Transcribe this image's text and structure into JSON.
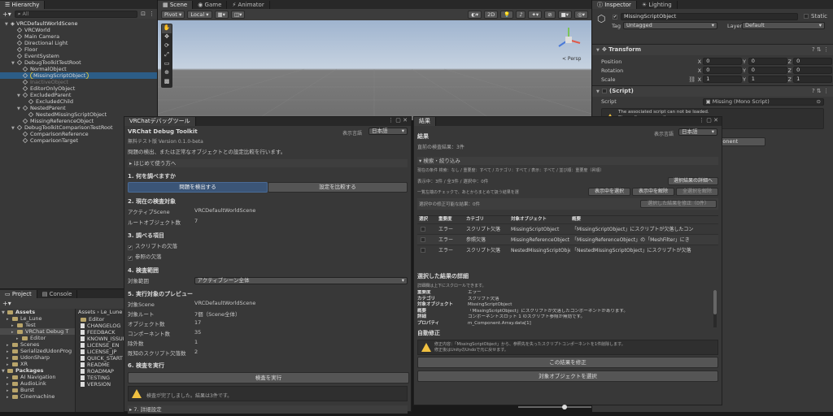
{
  "hierarchy": {
    "tab": "Hierarchy",
    "search_placeholder": "All",
    "scene": "VRCDefaultWorldScene",
    "items": [
      {
        "label": "VRCWorld",
        "indent": 2,
        "sel": false
      },
      {
        "label": "Main Camera",
        "indent": 2,
        "sel": false
      },
      {
        "label": "Directional Light",
        "indent": 2,
        "sel": false
      },
      {
        "label": "Floor",
        "indent": 2,
        "sel": false
      },
      {
        "label": "EventSystem",
        "indent": 2,
        "sel": false
      },
      {
        "label": "DebugToolkitTestRoot",
        "indent": 2,
        "sel": false,
        "open": true
      },
      {
        "label": "NormalObject",
        "indent": 3,
        "sel": false
      },
      {
        "label": "MissingScriptObject",
        "indent": 3,
        "sel": true
      },
      {
        "label": "InactiveObject",
        "indent": 3,
        "sel": false,
        "dim": true
      },
      {
        "label": "EditorOnlyObject",
        "indent": 3,
        "sel": false
      },
      {
        "label": "ExcludedParent",
        "indent": 3,
        "sel": false,
        "open": true
      },
      {
        "label": "ExcludedChild",
        "indent": 4,
        "sel": false
      },
      {
        "label": "NestedParent",
        "indent": 3,
        "sel": false,
        "open": true
      },
      {
        "label": "NestedMissingScriptObject",
        "indent": 4,
        "sel": false
      },
      {
        "label": "MissingReferenceObject",
        "indent": 3,
        "sel": false
      },
      {
        "label": "DebugToolkitComparisonTestRoot",
        "indent": 2,
        "sel": false,
        "open": true
      },
      {
        "label": "ComparisonReference",
        "indent": 3,
        "sel": false
      },
      {
        "label": "ComparisonTarget",
        "indent": 3,
        "sel": false
      }
    ]
  },
  "scene_view": {
    "tabs": [
      "Scene",
      "Game",
      "Animator"
    ],
    "pivot": "Pivot",
    "local": "Local",
    "mode2d": "2D",
    "persp": "< Persp"
  },
  "inspector": {
    "tabs": [
      "Inspector",
      "Lighting"
    ],
    "object_name": "MissingScriptObject",
    "static_label": "Static",
    "tag_label": "Tag",
    "tag_value": "Untagged",
    "layer_label": "Layer",
    "layer_value": "Default",
    "transform": "Transform",
    "position": "Position",
    "rotation": "Rotation",
    "scale": "Scale",
    "pos": [
      "0",
      "0",
      "0"
    ],
    "rot": [
      "0",
      "0",
      "0"
    ],
    "scl": [
      "1",
      "1",
      "1"
    ],
    "axes": [
      "X",
      "Y",
      "Z"
    ],
    "script_header": "(Script)",
    "script_label": "Script",
    "script_value": "Missing (Mono Script)",
    "warning": "The associated script can not be loaded.\nPlease fix any compile errors\nand assign a valid script.",
    "add_component": "Add Component"
  },
  "project": {
    "tabs": [
      "Project",
      "Console"
    ],
    "tree": [
      {
        "label": "Assets",
        "indent": 0,
        "bold": true
      },
      {
        "label": "Le_Lune",
        "indent": 1
      },
      {
        "label": "Test",
        "indent": 2
      },
      {
        "label": "VRChat Debug T",
        "indent": 2,
        "sel": true
      },
      {
        "label": "Editor",
        "indent": 3
      },
      {
        "label": "Scenes",
        "indent": 1
      },
      {
        "label": "SerializedUdonProg",
        "indent": 1
      },
      {
        "label": "UdonSharp",
        "indent": 1
      },
      {
        "label": "XR",
        "indent": 1
      },
      {
        "label": "Packages",
        "indent": 0,
        "bold": true
      },
      {
        "label": "AI Navigation",
        "indent": 1
      },
      {
        "label": "AudioLink",
        "indent": 1
      },
      {
        "label": "Burst",
        "indent": 1
      },
      {
        "label": "Cinemachine",
        "indent": 1
      }
    ],
    "breadcrumb": [
      "Assets",
      "Le_Lune"
    ],
    "files": [
      "Editor",
      "CHANGELOG",
      "FEEDBACK",
      "KNOWN_ISSUE",
      "LICENSE_EN",
      "LICENSE_JP",
      "QUICK_START",
      "README",
      "ROADMAP",
      "TESTING",
      "VERSION"
    ]
  },
  "debug": {
    "tab": "VRChatデバッグツール",
    "title": "VRChat Debug Toolkit",
    "version": "無料テスト版  Version 0.1.0-beta",
    "desc": "問題の検出、または正常なオブジェクトとの設定比較を行います。",
    "lang_label": "表示言語",
    "lang": "日本語",
    "howto": "▸ はじめて使う方へ",
    "s1": "1. 何を調べますか",
    "detect_btn": "問題を検出する",
    "compare_btn": "設定を比較する",
    "s2": "2. 現在の検査対象",
    "active_scene_label": "アクティブScene",
    "active_scene": "VRCDefaultWorldScene",
    "root_count_label": "ルートオブジェクト数",
    "root_count": "7",
    "s3": "3. 調べる項目",
    "chk1": "スクリプトの欠落",
    "chk2": "参照の欠落",
    "s4": "4. 検査範囲",
    "range_label": "対象範囲",
    "range_value": "アクティブシーン全体",
    "s5": "5. 実行対象のプレビュー",
    "preview": [
      [
        "対象Scene",
        "VRCDefaultWorldScene"
      ],
      [
        "対象ルート",
        "7個（Scene全体）"
      ],
      [
        "オブジェクト数",
        "17"
      ],
      [
        "コンポーネント数",
        "35"
      ],
      [
        "除外数",
        "1"
      ],
      [
        "既知のスクリプト欠落数",
        "2"
      ]
    ],
    "s6": "6. 検査を実行",
    "run_btn": "検査を実行",
    "done_msg": "検査が完了しました。結果は3件です。",
    "s7": "▸ 7. 詳細設定"
  },
  "results": {
    "tab": "結果",
    "title": "結果",
    "lang_label": "表示言語",
    "lang": "日本語",
    "subtitle": "直前の検査結果：3件",
    "filter_header": "▾ 検索・絞り込み",
    "filter_line": "現在の条件  検索：なし / 重要度：すべて / カテゴリ：すべて / 表示：すべて / 並び順：重要度（昇順）",
    "details_btn": "選択結果の詳細へ",
    "showing": "表示中：3件 / 全3件 / 選択中：0件",
    "bulk_note": "一覧左端のチェックで、あとからまとめて扱う結果を選",
    "select_shown": "表示中を選択",
    "deselect_shown": "表示中を解除",
    "deselect_all": "全選択を解除",
    "fixable": "選択中の修正可能な結果：0件",
    "fix_selected": "選択した結果を修正（0件）",
    "columns": [
      "選択",
      "重要度",
      "カテゴリ",
      "対象オブジェクト",
      "概要"
    ],
    "rows": [
      [
        "エラー",
        "スクリプト欠落",
        "MissingScriptObject",
        "「MissingScriptObject」にスクリプトが欠落したコン"
      ],
      [
        "エラー",
        "参照欠落",
        "MissingReferenceObject",
        "「MissingReferenceObject」の「MeshFilter」にき"
      ],
      [
        "エラー",
        "スクリプト欠落",
        "NestedMissingScriptObject",
        "「NestedMissingScriptObject」にスクリプトが欠落"
      ]
    ],
    "detail_header": "選択した結果の詳細",
    "detail_note": "詳細欄は上下にスクロールできます。",
    "detail": [
      [
        "重要度",
        "エラー"
      ],
      [
        "カテゴリ",
        "スクリプト欠落"
      ],
      [
        "対象オブジェクト",
        "MissingScriptObject"
      ],
      [
        "概要",
        "「MissingScriptObject」にスクリプトが欠落したコンポーネントがあります。"
      ],
      [
        "詳細",
        "コンポーネントスロット 1 のスクリプト参照が無効です。"
      ],
      [
        "プロパティ",
        "m_Component.Array.data[1]"
      ]
    ],
    "autofix": "自動修正",
    "autofix_msg1": "修正内容：「MissingScriptObject」から、参照先を失ったスクリプトコンポーネントを1件削除します。",
    "autofix_msg2": "修正後はUnityのUndoで元に戻せます。",
    "fix_btn": "この結果を修正",
    "select_obj_btn": "対象オブジェクトを選択"
  }
}
